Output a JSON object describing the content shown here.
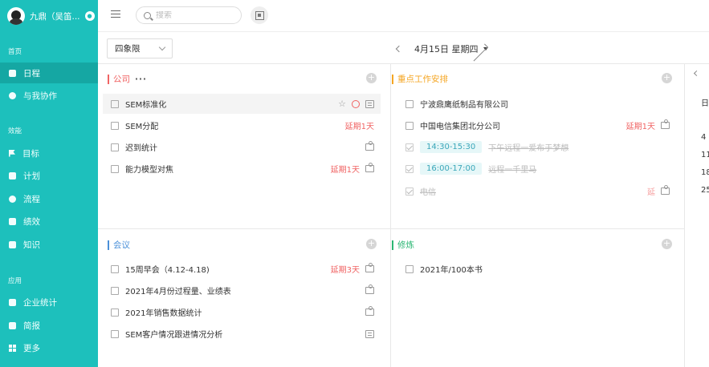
{
  "user": {
    "name": "九鼎（吴笛..."
  },
  "sidebar": {
    "sections": [
      {
        "label": "首页"
      },
      {
        "label": "效能"
      },
      {
        "label": "应用"
      }
    ],
    "items": [
      {
        "label": "日程",
        "icon": "calendar-icon"
      },
      {
        "label": "与我协作",
        "icon": "collaborate-icon"
      },
      {
        "label": "目标",
        "icon": "flag-icon"
      },
      {
        "label": "计划",
        "icon": "plan-icon"
      },
      {
        "label": "流程",
        "icon": "process-icon"
      },
      {
        "label": "绩效",
        "icon": "performance-icon"
      },
      {
        "label": "知识",
        "icon": "book-icon"
      },
      {
        "label": "企业统计",
        "icon": "stats-icon"
      },
      {
        "label": "简报",
        "icon": "report-icon"
      },
      {
        "label": "更多",
        "icon": "grid-icon"
      }
    ]
  },
  "search": {
    "placeholder": "搜索"
  },
  "toolbar": {
    "view": "四象限",
    "date": "4月15日 星期四"
  },
  "quadrants": {
    "company": {
      "title": "公司",
      "color": "#f06464",
      "tasks": [
        {
          "text": "SEM标准化"
        },
        {
          "text": "SEM分配",
          "late": "延期1天"
        },
        {
          "text": "迟到统计"
        },
        {
          "text": "能力模型对焦",
          "late": "延期1天"
        }
      ]
    },
    "work": {
      "title": "重点工作安排",
      "color": "#f5a623",
      "tasks": [
        {
          "text": "宁波鼎鹰纸制品有限公司"
        },
        {
          "text": "中国电信集团北分公司",
          "late": "延期1天"
        },
        {
          "time": "14:30-15:30",
          "text": "下午远程一爱布于梦想"
        },
        {
          "time": "16:00-17:00",
          "text": "远程一千里马"
        },
        {
          "text": "电信",
          "late": "延"
        }
      ]
    },
    "meeting": {
      "title": "会议",
      "color": "#4a90d9",
      "tasks": [
        {
          "text": "15周早会（4.12-4.18)",
          "late": "延期3天"
        },
        {
          "text": "2021年4月份过程量、业绩表"
        },
        {
          "text": "2021年销售数据统计"
        },
        {
          "text": "SEM客户情况跟进情况分析"
        }
      ]
    },
    "training": {
      "title": "修炼",
      "color": "#2bb673",
      "tasks": [
        {
          "text": "2021年/100本书"
        }
      ]
    }
  },
  "calendar_strip": {
    "header": "日",
    "days": [
      "4",
      "11",
      "18",
      "25"
    ]
  }
}
